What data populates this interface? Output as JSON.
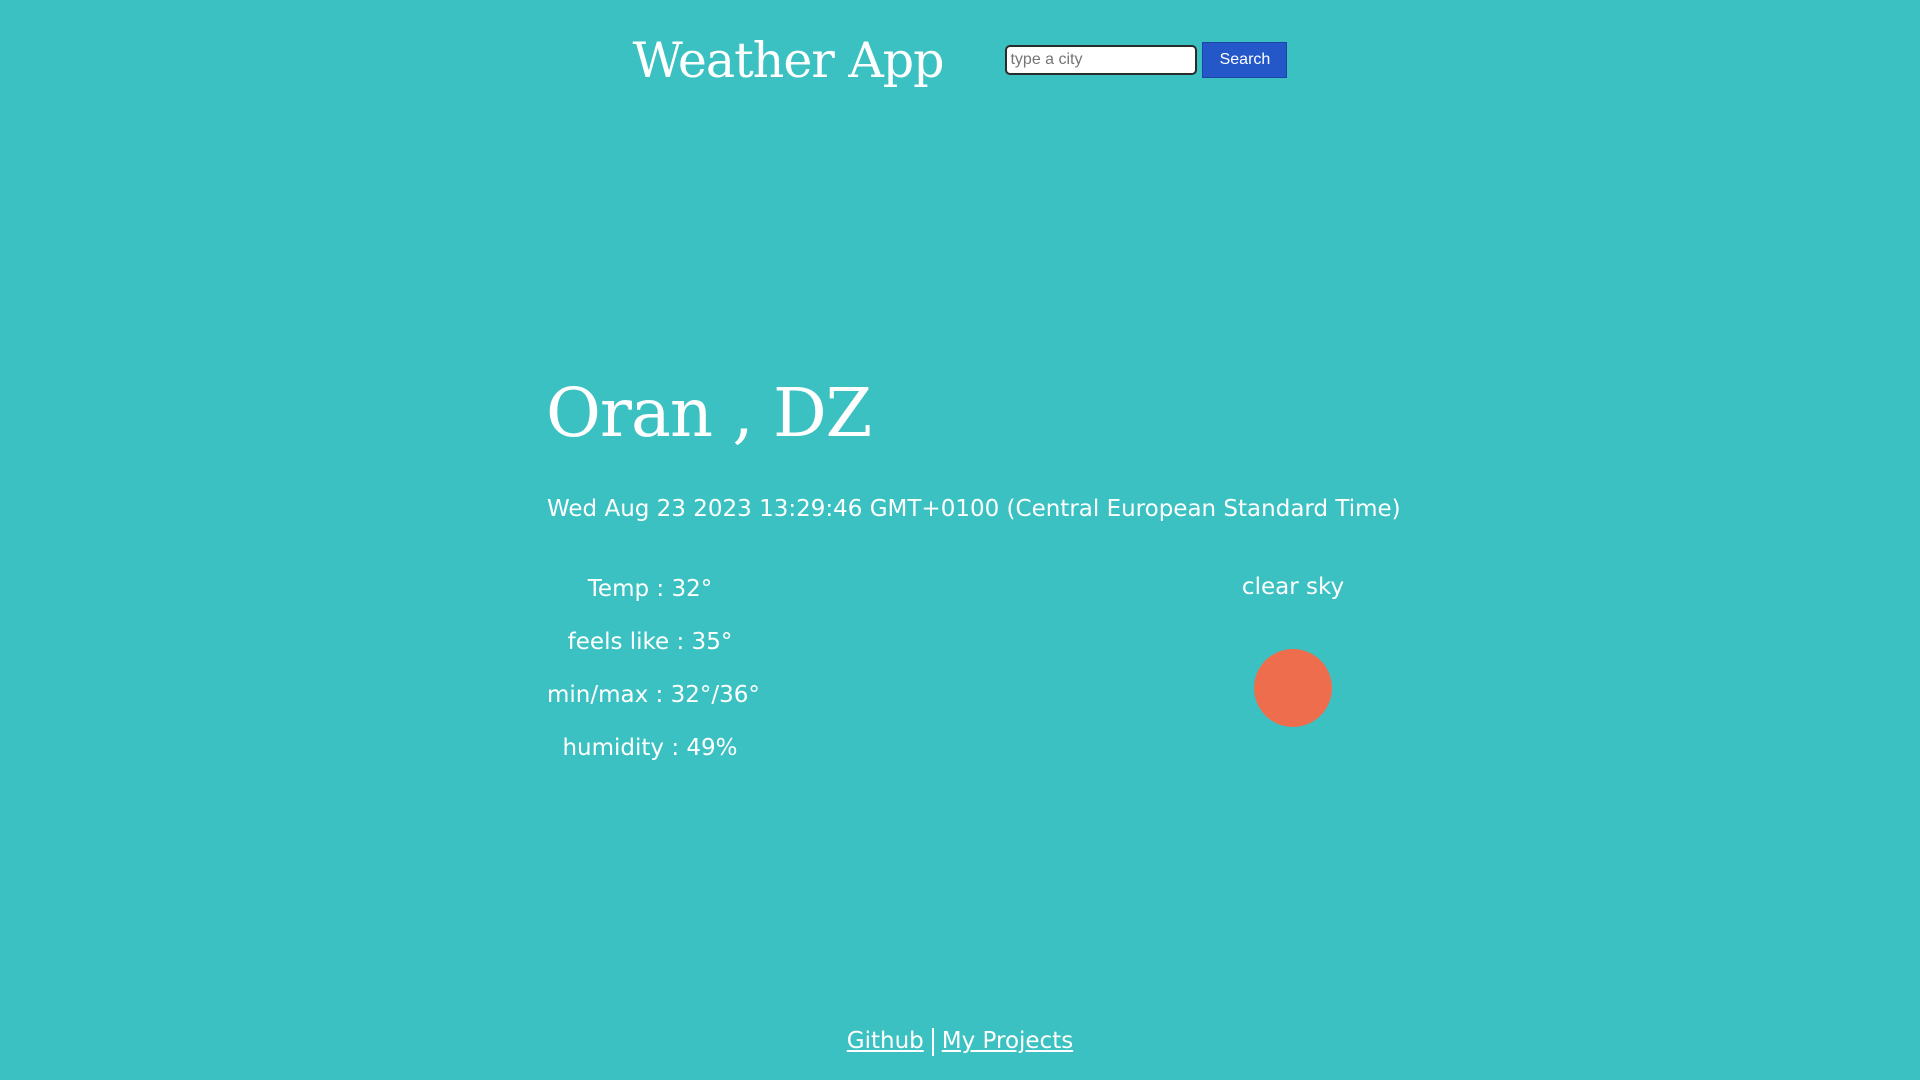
{
  "header": {
    "title": "Weather App",
    "search": {
      "placeholder": "type a city",
      "value": "",
      "button_label": "Search"
    }
  },
  "weather": {
    "location": "Oran , DZ",
    "datetime": "Wed Aug 23 2023 13:29:46 GMT+0100 (Central European Standard Time)",
    "stats": [
      "Temp : 32°",
      "feels like : 35°",
      "min/max : 32°/36°",
      "humidity : 49%"
    ],
    "condition": "clear sky",
    "condition_icon": "sun-icon"
  },
  "footer": {
    "links": [
      "Github",
      "My Projects"
    ]
  },
  "colors": {
    "background": "#3cc1c2",
    "accent_button": "#2458c9",
    "sun": "#ee6d4d",
    "text": "#ffffff"
  }
}
